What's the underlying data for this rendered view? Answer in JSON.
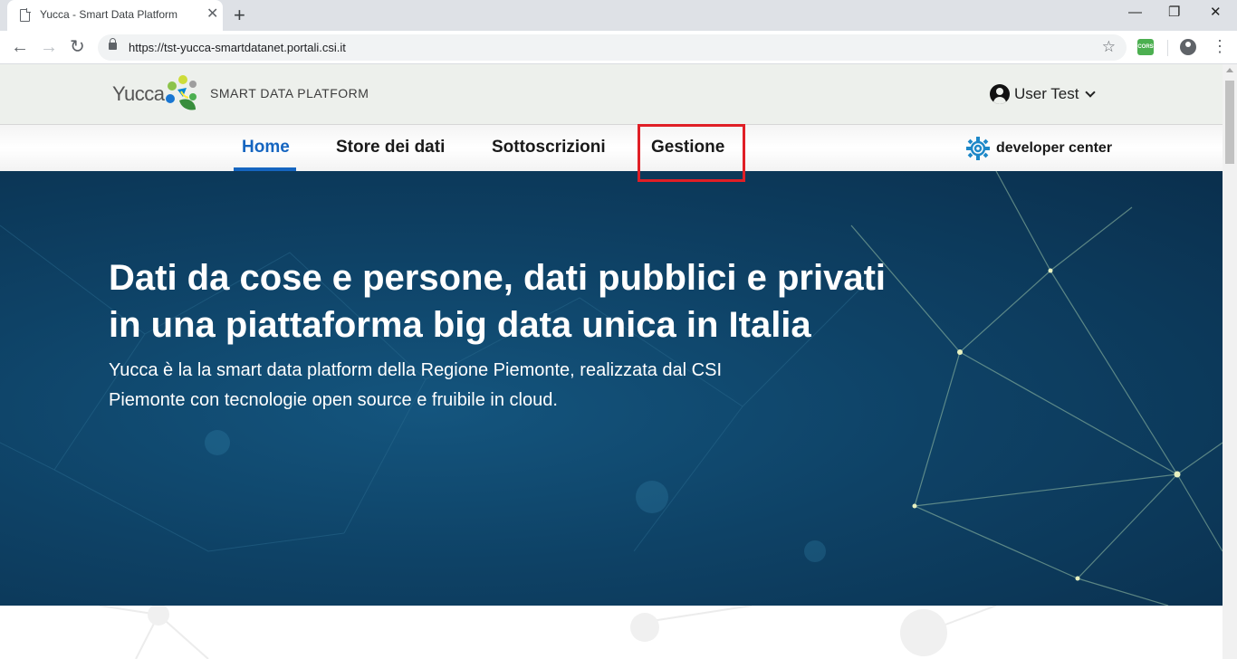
{
  "browser": {
    "tab_title": "Yucca - Smart Data Platform",
    "tab_close": "✕",
    "new_tab": "+",
    "url": "https://tst-yucca-smartdatanet.portali.csi.it",
    "ext_label": "CORS",
    "window_controls": {
      "minimize": "—",
      "maximize": "❐",
      "close": "✕"
    },
    "nav": {
      "back": "←",
      "forward": "→",
      "reload": "↻",
      "bookmark": "☆",
      "menu": "⋮"
    }
  },
  "header": {
    "logo_word": "Yucca",
    "tagline": "SMART DATA PLATFORM",
    "user_name": "User Test"
  },
  "nav": {
    "items": [
      {
        "label": "Home",
        "active": true
      },
      {
        "label": "Store dei dati",
        "active": false
      },
      {
        "label": "Sottoscrizioni",
        "active": false
      },
      {
        "label": "Gestione",
        "active": false,
        "highlighted": true
      }
    ],
    "developer_center": "developer center"
  },
  "hero": {
    "title": "Dati da cose e persone, dati pubblici e privati in una piattaforma big data unica in Italia",
    "subtitle": "Yucca è la la smart data platform della Regione Piemonte, realizzata dal CSI Piemonte con tecnologie open source e fruibile in cloud."
  },
  "colors": {
    "accent": "#1565c0",
    "highlight": "#e01f26",
    "hero_bg": "#0e4266",
    "header_bg": "#edf0ec"
  }
}
